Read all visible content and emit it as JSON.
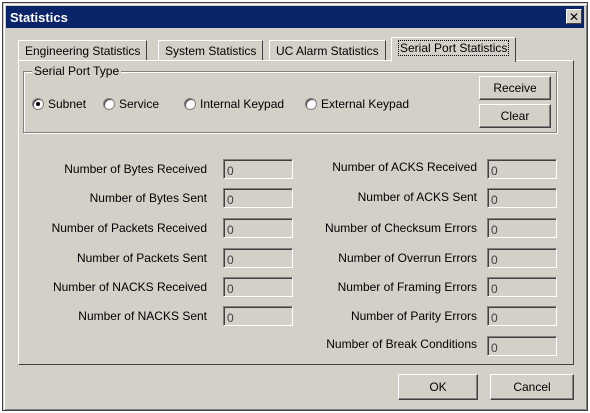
{
  "window": {
    "title": "Statistics",
    "close_glyph": "✕"
  },
  "tabs": [
    {
      "label": "Engineering Statistics"
    },
    {
      "label": "System Statistics"
    },
    {
      "label": "UC Alarm Statistics"
    },
    {
      "label": "Serial Port Statistics",
      "active": true
    }
  ],
  "serial_port_type": {
    "label": "Serial Port Type",
    "options": [
      {
        "label": "Subnet",
        "selected": true
      },
      {
        "label": "Service",
        "selected": false
      },
      {
        "label": "Internal Keypad",
        "selected": false
      },
      {
        "label": "External Keypad",
        "selected": false
      }
    ]
  },
  "buttons": {
    "receive": "Receive",
    "clear": "Clear",
    "ok": "OK",
    "cancel": "Cancel"
  },
  "left_stats": [
    {
      "label": "Number of Bytes Received",
      "value": "0"
    },
    {
      "label": "Number of Bytes Sent",
      "value": "0"
    },
    {
      "label": "Number of Packets Received",
      "value": "0"
    },
    {
      "label": "Number of Packets Sent",
      "value": "0"
    },
    {
      "label": "Number of NACKS Received",
      "value": "0"
    },
    {
      "label": "Number of NACKS Sent",
      "value": "0"
    }
  ],
  "right_stats": [
    {
      "label": "Number of ACKS Received",
      "value": "0"
    },
    {
      "label": "Number of ACKS Sent",
      "value": "0"
    },
    {
      "label": "Number of Checksum Errors",
      "value": "0"
    },
    {
      "label": "Number of Overrun Errors",
      "value": "0"
    },
    {
      "label": "Number of Framing Errors",
      "value": "0"
    },
    {
      "label": "Number of Parity Errors",
      "value": "0"
    },
    {
      "label": "Number of Break Conditions",
      "value": "0"
    }
  ]
}
